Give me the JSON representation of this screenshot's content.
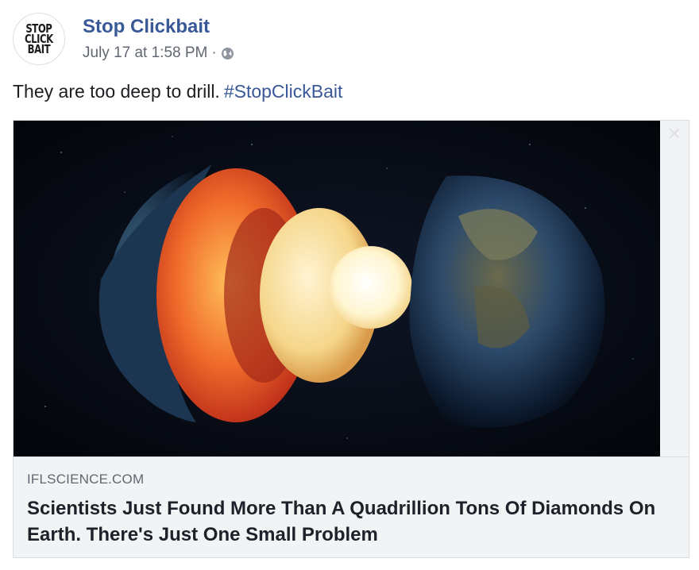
{
  "page": {
    "name": "Stop Clickbait",
    "avatar_text": [
      "STOP",
      "CLICK",
      "BAIT"
    ],
    "timestamp": "July 17 at 1:58 PM",
    "separator": "·",
    "privacy_icon": "globe-icon"
  },
  "status": {
    "text": "They are too deep to drill.",
    "hashtag": "#StopClickBait"
  },
  "link_card": {
    "image_icon": "earth-layers-illustration",
    "close_icon": "close-icon",
    "close_glyph": "✕",
    "domain": "IFLSCIENCE.COM",
    "headline": "Scientists Just Found More Than A Quadrillion Tons Of Diamonds On Earth. There's Just One Small Problem"
  },
  "colors": {
    "link": "#385898",
    "secondary_text": "#606770",
    "card_bg": "#f2f3f5"
  }
}
